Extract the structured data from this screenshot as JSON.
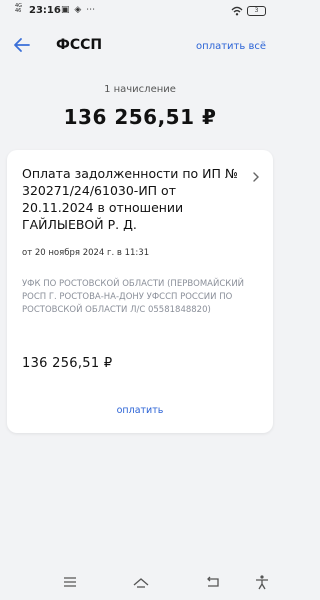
{
  "status_bar": {
    "signal": "4G",
    "signal2": "46",
    "time": "23:16",
    "icons": "▣ ◈ ⋯",
    "battery": "3"
  },
  "header": {
    "title": "ФССП",
    "pay_all": "оплатить всё"
  },
  "summary": {
    "count_label": "1 начисление",
    "total": "136 256,51 ₽"
  },
  "charge": {
    "title": "Оплата задолженности по ИП № 320271/24/61030-ИП от 20.11.2024 в отношении ГАЙЛЫЕВОЙ Р. Д.",
    "datetime": "от 20 ноября 2024 г. в 11:31",
    "recipient": "УФК ПО РОСТОВСКОЙ ОБЛАСТИ (ПЕРВОМАЙСКИЙ РОСП Г. РОСТОВА-НА-ДОНУ УФССП РОССИИ ПО РОСТОВСКОЙ ОБЛАСТИ Л/С 05581848820)",
    "amount": "136 256,51 ₽",
    "pay_label": "оплатить"
  },
  "colors": {
    "accent": "#2b63d6",
    "background": "#f2f3f5",
    "card": "#ffffff",
    "muted": "#8a8f99"
  },
  "icons": {
    "back": "arrow-left-icon",
    "chevron": "chevron-right-icon",
    "nav": [
      "menu-icon",
      "home-icon",
      "back-icon",
      "accessibility-icon"
    ]
  }
}
